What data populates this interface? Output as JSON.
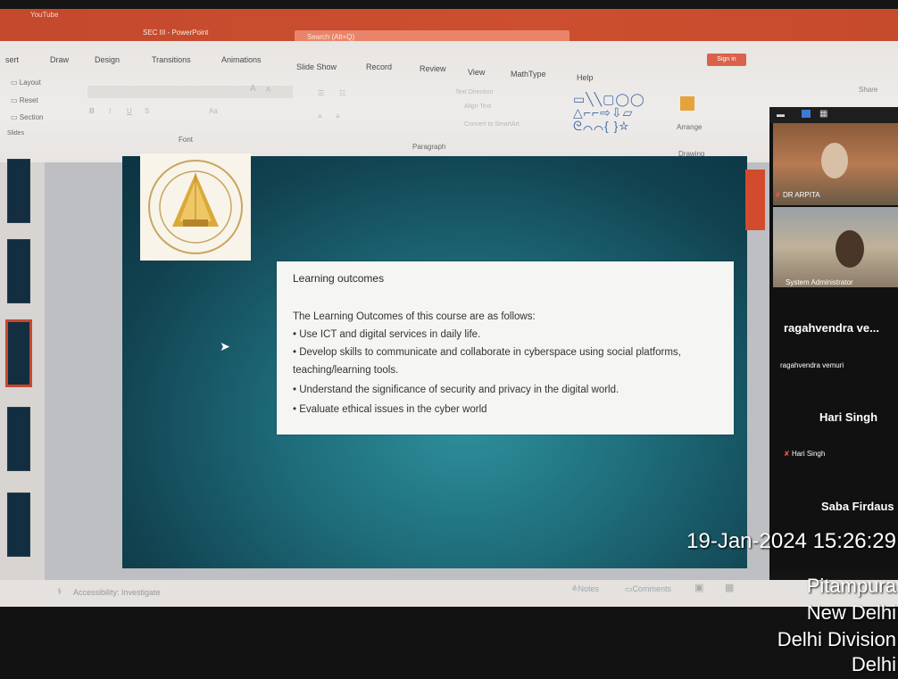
{
  "titlebar": {
    "browser_tab": "YouTube",
    "app_title": "SEC III  -  PowerPoint",
    "search_placeholder": "Search (Alt+Q)",
    "sign_in": "Sign in"
  },
  "ribbon": {
    "tabs": [
      "sert",
      "Draw",
      "Design",
      "Transitions",
      "Animations",
      "Slide Show",
      "Record",
      "Review",
      "View",
      "MathType",
      "Help"
    ],
    "share": "Share",
    "slides_group": {
      "layout": "Layout",
      "reset": "Reset",
      "section": "Section",
      "label": "Slides"
    },
    "font_label": "Font",
    "paragraph_label": "Paragraph",
    "drawing_label": "Drawing",
    "arrange": "Arrange",
    "text_direction": "Text Direction",
    "align_text": "Align Text",
    "convert_smartart": "Convert to SmartArt"
  },
  "slide": {
    "title": "Learning outcomes",
    "intro": "The Learning Outcomes of this course are as follows:",
    "bullets": [
      "• Use ICT and digital services in daily life.",
      "• Develop skills to communicate and collaborate in cyberspace using social platforms,",
      "teaching/learning tools.",
      "• Understand the significance of security and privacy in the digital world.",
      "• Evaluate ethical issues in the cyber world"
    ]
  },
  "participants": {
    "p1": "DR ARPITA",
    "p2": "System Administrator",
    "p3_big": "ragahvendra  ve...",
    "p3_small": "ragahvendra vemuri",
    "p4_big": "Hari Singh",
    "p4_small": "Hari Singh",
    "p5_big": "Saba Firdaus"
  },
  "statusbar": {
    "accessibility": "Accessibility: Investigate",
    "notes": "Notes",
    "comments": "Comments"
  },
  "stamp": {
    "datetime": "19-Jan-2024 15:26:29",
    "line1": "Pitampura",
    "line2": "New Delhi",
    "line3": "Delhi Division",
    "line4": "Delhi"
  },
  "colors": {
    "accent": "#c9472c",
    "slide_teal": "#1f6e7c"
  }
}
